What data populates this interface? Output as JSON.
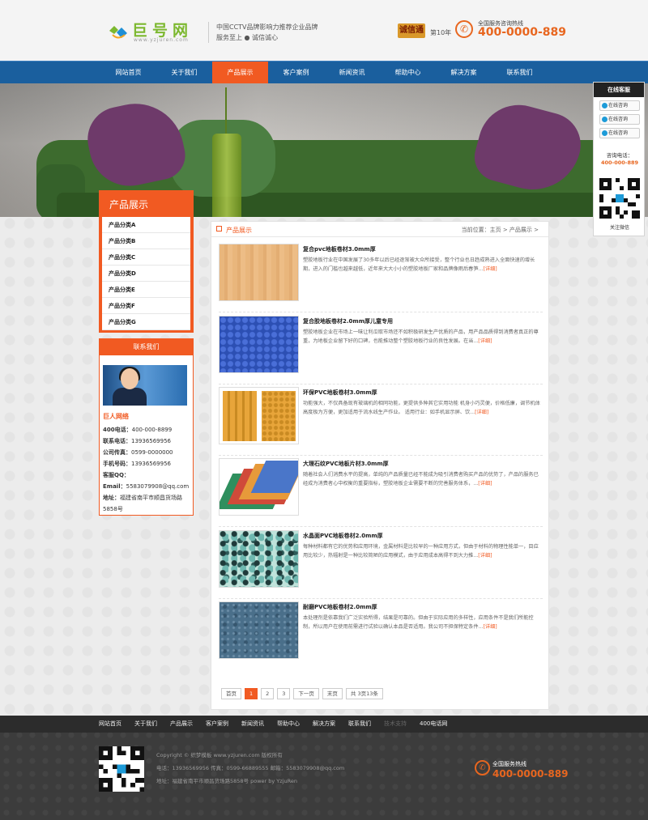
{
  "header": {
    "logo_text": "巨号网",
    "logo_sub": "www.yzjuren.com",
    "slogan_line1": "中国CCTV品牌影响力推荐企业品牌",
    "slogan_line2": "服务至上 ● 诚信诚心",
    "badge": "诚信通",
    "badge_years": "第10年",
    "hotline_label": "全国服务咨询热线",
    "hotline_number": "400-0000-889"
  },
  "nav": [
    {
      "label": "网站首页",
      "active": false
    },
    {
      "label": "关于我们",
      "active": false
    },
    {
      "label": "产品展示",
      "active": true
    },
    {
      "label": "客户案例",
      "active": false
    },
    {
      "label": "新闻资讯",
      "active": false
    },
    {
      "label": "帮助中心",
      "active": false
    },
    {
      "label": "解决方案",
      "active": false
    },
    {
      "label": "联系我们",
      "active": false
    }
  ],
  "sidebar": {
    "categories_title": "产品展示",
    "categories": [
      "产品分类A",
      "产品分类B",
      "产品分类C",
      "产品分类D",
      "产品分类E",
      "产品分类F",
      "产品分类G"
    ],
    "contact_title": "联系我们",
    "contact_company": "巨人网络",
    "contact_lines": [
      {
        "label": "400电话：",
        "value": "400-000-8899"
      },
      {
        "label": "联系电话：",
        "value": "13936569956"
      },
      {
        "label": "公司传真：",
        "value": "0599-0000000"
      },
      {
        "label": "手机号码：",
        "value": "13936569956"
      },
      {
        "label": "客服QQ：",
        "value": ""
      },
      {
        "label": "Email：",
        "value": "5583079908@qq.com"
      },
      {
        "label": "地址：",
        "value": "福建省南平市顺昌货场路5858号"
      }
    ]
  },
  "main": {
    "title": "产品展示",
    "breadcrumb": "当前位置：主页 > 产品展示 >",
    "more_label": "[详细]",
    "products": [
      {
        "title": "复合pvc地板卷材3.0mm厚",
        "desc": "塑胶地板行业在中国发展了30多年以后已经逐渐被大众所接受，整个行业也日趋成熟进入全面快速的增长期，进入的门槛也越来越低，近年来大大小小的塑胶地板厂家和品牌像雨后春笋...",
        "img": "wood"
      },
      {
        "title": "复合胶地板卷材2.0mm厚儿童专用",
        "desc": "塑胶地板企业在市场上一味让利瓜取市场还不如积极研发生产优质的产品，用产品品质得到消费者真正的尊重，为地板企业留下好的口碑，也能推动整个塑胶地板行业的良性发展。在当...",
        "img": "blue-dots"
      },
      {
        "title": "环保PVC地板卷材3.0mm厚",
        "desc": "功能强大，不仅具备现有玻璃机的相同功能，更提供多种其它实用功能 机身小巧灵便，价格低廉，调节机体高度极为方便，更加适用于流水线生产作业。 适用行业：如手机显示屏、饮...",
        "img": "tactile"
      },
      {
        "title": "大理石纹PVC地板片材3.0mm厚",
        "desc": "随着社会人们消费水平的提高，单纯的产品质量已经不能成为吸引消费者购买产品的优势了，产品的服务已经成为消费者心中权衡的重要指标，塑胶地板企业需要不断的完善服务体系，...",
        "img": "rolls"
      },
      {
        "title": "水晶面PVC地板卷材2.0mm厚",
        "desc": "每种材料都有它的优势和应用环境，金属材料是比较早的一种应用方式，但由于材料的物理性能单一，目应用比较少，热辐射是一种比较简陋的应用模式，由于应用成本高得不到大力推...",
        "img": "mosaic"
      },
      {
        "title": "耐磨PVC地板卷材2.0mm厚",
        "desc": "本处理剂是依靠我们广泛实验所得，结果是可靠的。但由于实际应用的多样性，应用条件不是我们所能控制，所以用户在使用前需进行试验以确认本品是否适用。我公司不担保特定条件...",
        "img": "speckle"
      }
    ],
    "pager": [
      "首页",
      "1",
      "2",
      "3",
      "下一页",
      "末页",
      "共 3页13条"
    ],
    "pager_current": "1"
  },
  "float_service": {
    "title": "在线客服",
    "buttons": [
      "在线咨询",
      "在线咨询",
      "在线咨询"
    ],
    "tel_label": "咨询电话：",
    "tel": "400-000-889",
    "qr_label": "关注微信"
  },
  "footer": {
    "nav": [
      "网站首页",
      "关于我们",
      "产品展示",
      "客户案例",
      "新闻资讯",
      "帮助中心",
      "解决方案",
      "联系我们",
      "技术支持",
      "400电话网"
    ],
    "copyright": "Copyright © 织梦模板 www.yzjuren.com 版权所有",
    "contacts": "电话：13936569956 传真：0599-66889555 邮箱：5583079908@qq.com",
    "address": "地址：福建省南平市顺昌货场路5858号 power by YzjuRen",
    "hotline_label": "全国服务热线",
    "hotline_number": "400-0000-889"
  },
  "colors": {
    "accent": "#f15a22",
    "nav": "#1a5f9e",
    "hotline": "#e8661f",
    "logo": "#7cb82f"
  }
}
